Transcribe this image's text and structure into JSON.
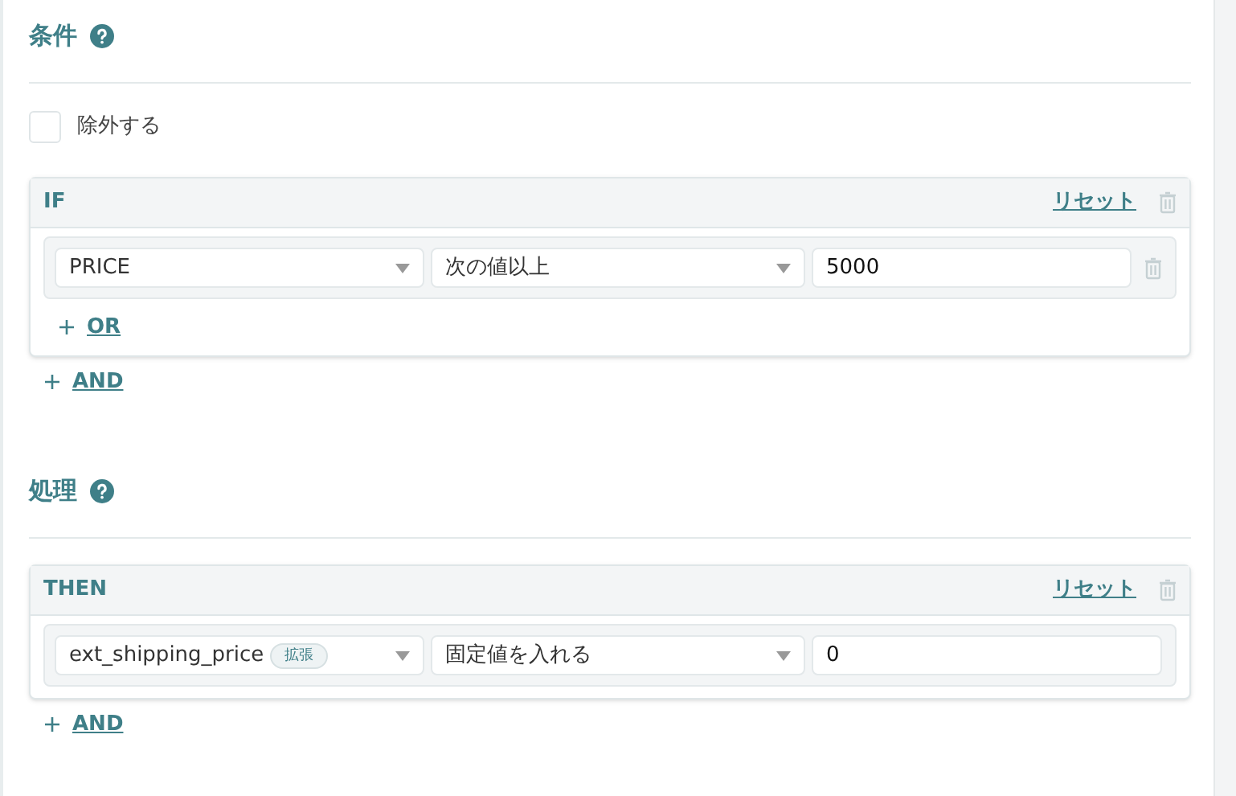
{
  "sections": [
    {
      "title": "条件",
      "exclude": {
        "label": "除外する",
        "checked": false
      },
      "block": {
        "label": "IF",
        "reset": "リセット",
        "rows": [
          {
            "field": "PRICE",
            "tag": null,
            "operator": "次の値以上",
            "value": "5000",
            "removable": true
          }
        ],
        "or_link": "OR"
      },
      "and_link": "AND"
    },
    {
      "title": "処理",
      "block": {
        "label": "THEN",
        "reset": "リセット",
        "rows": [
          {
            "field": "ext_shipping_price",
            "tag": "拡張",
            "operator": "固定値を入れる",
            "value": "0",
            "removable": false
          }
        ]
      },
      "and_link": "AND"
    }
  ]
}
